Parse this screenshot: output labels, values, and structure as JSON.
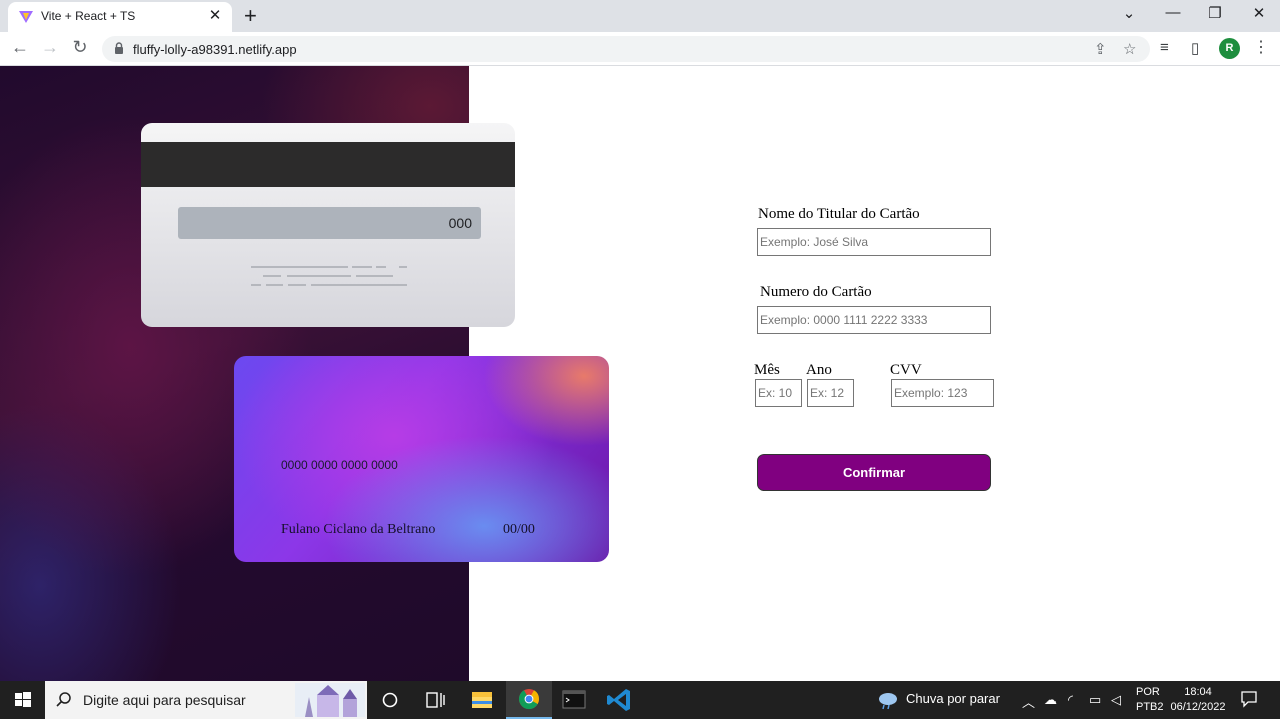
{
  "browser": {
    "tab_title": "Vite + React + TS",
    "tab_close": "✕",
    "new_tab": "+",
    "url": "fluffy-lolly-a98391.netlify.app",
    "profile_initial": "R",
    "window_controls": {
      "dropdown": "⌄",
      "minimize": "—",
      "restore": "❐",
      "close": "✕"
    }
  },
  "card_back": {
    "cvv": "000"
  },
  "card_front": {
    "number": "0000 0000 0000 0000",
    "holder": "Fulano Ciclano da Beltrano",
    "expiry": "00/00"
  },
  "form": {
    "name_label": "Nome do Titular do Cartão",
    "name_placeholder": "Exemplo: José Silva",
    "number_label": "Numero do Cartão",
    "number_placeholder": "Exemplo: 0000 1111 2222 3333",
    "month_label": "Mês",
    "month_placeholder": "Ex: 10",
    "year_label": "Ano",
    "year_placeholder": "Ex: 12",
    "cvv_label": "CVV",
    "cvv_placeholder": "Exemplo: 123",
    "confirm_label": "Confirmar"
  },
  "taskbar": {
    "search_text": "Digite aqui para pesquisar",
    "weather_text": "Chuva por parar",
    "lang_line1": "POR",
    "lang_line2": "PTB2",
    "time": "18:04",
    "date": "06/12/2022"
  },
  "colors": {
    "accent_button": "#800080",
    "card_gradient": [
      "#6b49f0",
      "#b63ce6",
      "#e87a6a",
      "#6a8cf0",
      "#6a16a6"
    ],
    "left_background": "#2a0d33"
  },
  "icons": [
    "vite-logo-icon",
    "back-icon",
    "forward-icon",
    "reload-icon",
    "lock-icon",
    "share-icon",
    "star-icon",
    "media-icon",
    "side-panel-icon",
    "kebab-menu-icon",
    "windows-start-icon",
    "search-icon",
    "cortana-icon",
    "task-view-icon",
    "file-explorer-icon",
    "chrome-icon",
    "terminal-icon",
    "vscode-icon",
    "weather-icon",
    "notification-icon"
  ]
}
